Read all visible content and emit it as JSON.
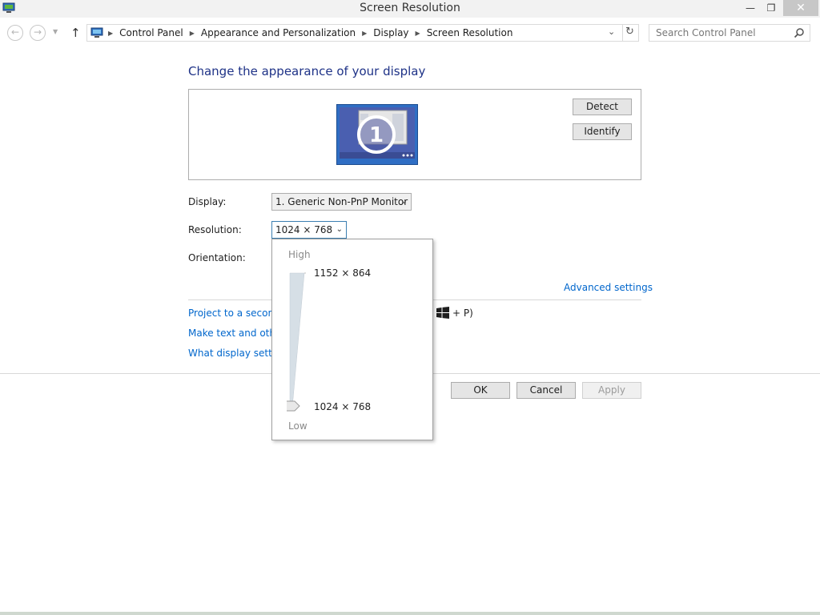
{
  "window": {
    "title": "Screen Resolution",
    "minimize_glyph": "—",
    "restore_glyph": "❐",
    "close_glyph": "✕"
  },
  "nav": {
    "back_glyph": "←",
    "forward_glyph": "→",
    "recent_glyph": "▼",
    "up_glyph": "↑",
    "breadcrumbs": [
      "Control Panel",
      "Appearance and Personalization",
      "Display",
      "Screen Resolution"
    ],
    "dropdown_glyph": "⌄",
    "refresh_glyph": "↻",
    "search_placeholder": "Search Control Panel"
  },
  "main": {
    "heading": "Change the appearance of your display",
    "monitor_number": "1",
    "detect_label": "Detect",
    "identify_label": "Identify",
    "display_label": "Display:",
    "display_value": "1. Generic Non-PnP Monitor",
    "resolution_label": "Resolution:",
    "resolution_value": "1024 × 768",
    "orientation_label": "Orientation:",
    "advanced_link": "Advanced settings",
    "links": [
      "Project to a second",
      "Make text and other",
      "What display setting"
    ],
    "win_hint": "+ P)",
    "ok_label": "OK",
    "cancel_label": "Cancel",
    "apply_label": "Apply"
  },
  "resolution_popup": {
    "high_label": "High",
    "low_label": "Low",
    "max_value": "1152 × 864",
    "current_value": "1024 × 768",
    "slider_position": 0.0
  },
  "colors": {
    "heading": "#1e3287",
    "link": "#0066cc",
    "monitor_fill": "#4a5fb0"
  }
}
